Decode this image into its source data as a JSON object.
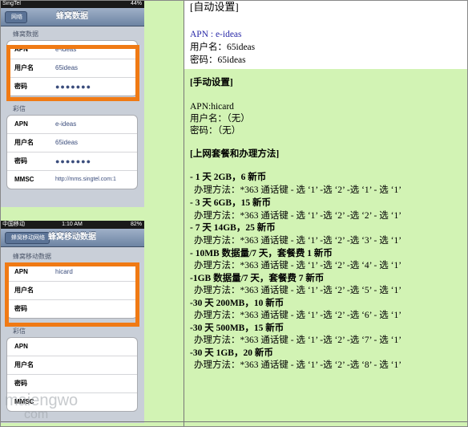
{
  "phone1": {
    "status": {
      "carrier": "SingTel",
      "battery": "44%"
    },
    "nav": {
      "back": "网络",
      "title": "蜂窝数据"
    },
    "section1": "蜂窝数据",
    "rows1": [
      {
        "key": "APN",
        "value": "e-ideas"
      },
      {
        "key": "用户名",
        "value": "65ideas"
      },
      {
        "key": "密码",
        "value": "●●●●●●●"
      }
    ],
    "section2": "彩信",
    "rows2": [
      {
        "key": "APN",
        "value": "e-ideas"
      },
      {
        "key": "用户名",
        "value": "65ideas"
      },
      {
        "key": "密码",
        "value": "●●●●●●●"
      },
      {
        "key": "MMSC",
        "value": "http://mms.singtel.com:1"
      }
    ]
  },
  "phone2": {
    "status": {
      "carrier": "中国移动",
      "time": "1:10 AM",
      "battery": "82%"
    },
    "nav": {
      "back": "蜂窝移动网络",
      "title": "蜂窝移动数据"
    },
    "section1": "蜂窝移动数据",
    "rows1": [
      {
        "key": "APN",
        "value": "hicard"
      },
      {
        "key": "用户名",
        "value": ""
      },
      {
        "key": "密码",
        "value": ""
      }
    ],
    "section2": "彩信",
    "rows2": [
      {
        "key": "APN",
        "value": ""
      },
      {
        "key": "用户名",
        "value": ""
      },
      {
        "key": "密码",
        "value": ""
      },
      {
        "key": "MMSC",
        "value": ""
      }
    ]
  },
  "watermark": {
    "line1": "maiengwo",
    "line2": "com"
  },
  "auto": {
    "heading": "[自动设置]",
    "apn": "APN : e-ideas",
    "user": "用户名：65ideas",
    "pass": "密码：65ideas"
  },
  "manual": {
    "heading": "[手动设置]",
    "apn": "APN:hicard",
    "user": "用户名：（无）",
    "pass": "密码：（无）"
  },
  "plans": {
    "heading": "[上网套餐和办理方法]",
    "items": [
      {
        "title": "- 1 天 2GB，6 新币",
        "method": "办理方法：*363 通话键 - 选 ‘1’ -选 ‘2’ -选 ‘1’ - 选 ‘1’"
      },
      {
        "title": "- 3 天 6GB，15 新币",
        "method": "办理方法：*363 通话键 - 选 ‘1’ -选 ‘2’ -选 ‘2’ - 选 ‘1’"
      },
      {
        "title": "- 7 天 14GB，25 新币",
        "method": "办理方法：*363 通话键 - 选 ‘1’ -选 ‘2’ -选 ‘3’ - 选 ‘1’"
      },
      {
        "title": "- 10MB 数据量/7 天，套餐费 1 新币",
        "method": "办理方法：*363 通话键 - 选 ‘1’ -选 ‘2’ -选 ‘4’ - 选 ‘1’"
      },
      {
        "title": "-1GB 数据量/7 天，套餐费 7 新币",
        "method": "办理方法：*363 通话键 - 选 ‘1’ -选 ‘2’ -选 ‘5’ - 选 ‘1’"
      },
      {
        "title": "-30 天 200MB，10 新币",
        "method": "办理方法：*363 通话键 - 选 ‘1’ -选 ‘2’ -选 ‘6’ - 选 ‘1’"
      },
      {
        "title": "-30 天 500MB，15 新币",
        "method": "办理方法：*363 通话键 - 选 ‘1’ -选 ‘2’ -选 ‘7’ - 选 ‘1’"
      },
      {
        "title": "-30 天 1GB，20 新币",
        "method": "办理方法：*363 通话键 - 选 ‘1’ -选 ‘2’ -选 ‘8’ - 选 ‘1’"
      }
    ]
  },
  "colors": {
    "cell_bg": "#d2f3b4",
    "highlight": "#f07a14",
    "link": "#2a2aa8"
  }
}
